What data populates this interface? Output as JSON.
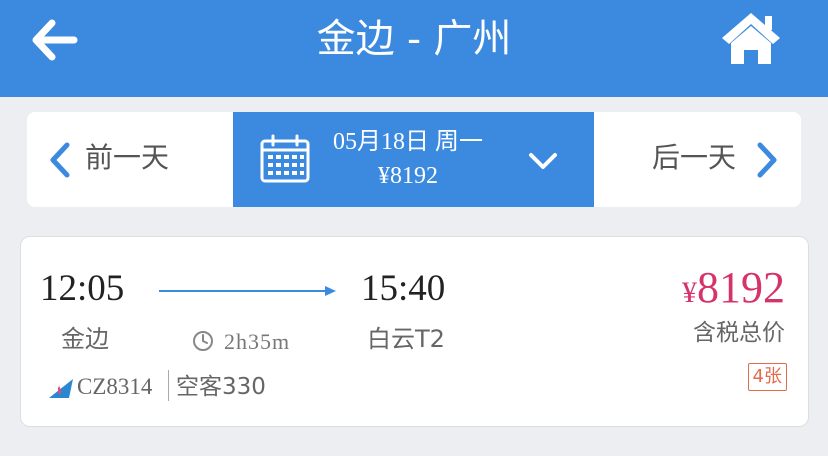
{
  "header": {
    "title": "金边 - 广州",
    "back_icon": "back-arrow-icon",
    "home_icon": "home-icon"
  },
  "date_bar": {
    "prev_label": "前一天",
    "next_label": "后一天",
    "date": "05月18日 周一",
    "price": "¥8192"
  },
  "flight": {
    "departure_time": "12:05",
    "arrival_time": "15:40",
    "departure_airport": "金边",
    "arrival_airport": "白云T2",
    "duration": "2h35m",
    "flight_number": "CZ8314",
    "aircraft": "空客330",
    "price_currency": "¥",
    "price_amount": "8192",
    "price_label": "含税总价",
    "tickets_left": "4张"
  },
  "colors": {
    "primary": "#3c8ae0",
    "price": "#d6336c",
    "tickets": "#e36a4b"
  }
}
